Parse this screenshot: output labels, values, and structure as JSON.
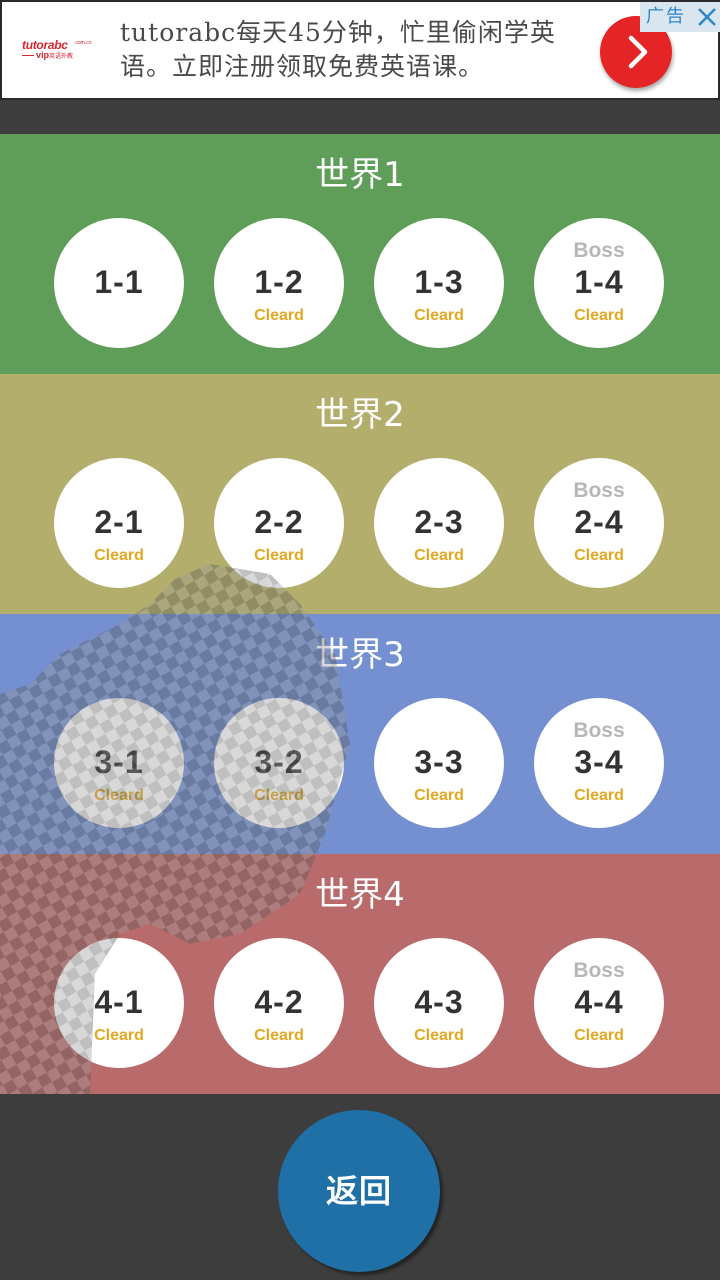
{
  "ad": {
    "logo_text": "tutorabc",
    "logo_sub": ".com.cn",
    "logo_vip": "vip",
    "logo_vip_cn": "英语外教",
    "headline": "tutorabc每天45分钟，忙里偷闲学英语。立即注册领取免费英语课。",
    "tag": "广告",
    "colors": {
      "arrow": "#e52525",
      "tag_bg": "#d9e6ef",
      "tag_text": "#2d86c9"
    }
  },
  "worlds": [
    {
      "title": "世界1",
      "color": "#5f9e58",
      "stages": [
        {
          "label": "1-1",
          "boss": "",
          "status": ""
        },
        {
          "label": "1-2",
          "boss": "",
          "status": "Cleard"
        },
        {
          "label": "1-3",
          "boss": "",
          "status": "Cleard"
        },
        {
          "label": "1-4",
          "boss": "Boss",
          "status": "Cleard"
        }
      ]
    },
    {
      "title": "世界2",
      "color": "#b4ae6c",
      "stages": [
        {
          "label": "2-1",
          "boss": "",
          "status": "Cleard"
        },
        {
          "label": "2-2",
          "boss": "",
          "status": "Cleard"
        },
        {
          "label": "2-3",
          "boss": "",
          "status": "Cleard"
        },
        {
          "label": "2-4",
          "boss": "Boss",
          "status": "Cleard"
        }
      ]
    },
    {
      "title": "世界3",
      "color": "#7490d0",
      "stages": [
        {
          "label": "3-1",
          "boss": "",
          "status": "Cleard"
        },
        {
          "label": "3-2",
          "boss": "",
          "status": "Cleard"
        },
        {
          "label": "3-3",
          "boss": "",
          "status": "Cleard"
        },
        {
          "label": "3-4",
          "boss": "Boss",
          "status": "Cleard"
        }
      ]
    },
    {
      "title": "世界4",
      "color": "#b96a6a",
      "stages": [
        {
          "label": "4-1",
          "boss": "",
          "status": "Cleard"
        },
        {
          "label": "4-2",
          "boss": "",
          "status": "Cleard"
        },
        {
          "label": "4-3",
          "boss": "",
          "status": "Cleard"
        },
        {
          "label": "4-4",
          "boss": "Boss",
          "status": "Cleard"
        }
      ]
    }
  ],
  "back_button": {
    "label": "返回",
    "color": "#1f70a6"
  }
}
